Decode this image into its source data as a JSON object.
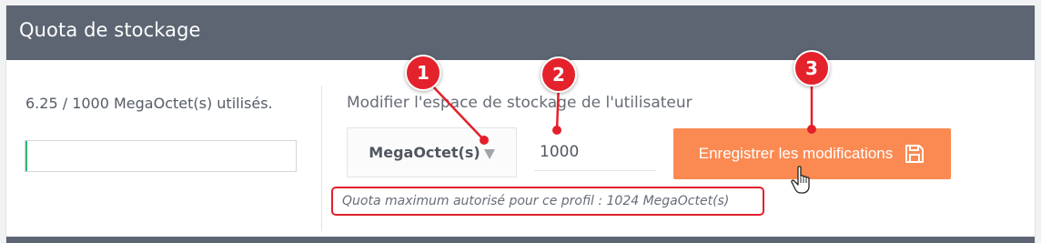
{
  "panel": {
    "title": "Quota de stockage"
  },
  "usage": {
    "text": "6.25 / 1000 MegaOctet(s) utilisés.",
    "fraction": 0.00625
  },
  "edit": {
    "label": "Modifier l'espace de stockage de l'utilisateur",
    "unit_selected": "MegaOctet(s)",
    "quota_value": "1000",
    "save_label": "Enregistrer les modifications",
    "hint": "Quota maximum autorisé pour ce profil : 1024 MegaOctet(s)"
  },
  "annotations": {
    "badges": [
      "1",
      "2",
      "3"
    ],
    "color": "#e3202a"
  },
  "colors": {
    "header": "#5d6572",
    "accent": "#fb8a52",
    "progress": "#2eb872"
  },
  "icons": {
    "save": "floppy-disk-icon",
    "dropdown": "caret-down-icon",
    "cursor": "hand-pointer-icon"
  }
}
